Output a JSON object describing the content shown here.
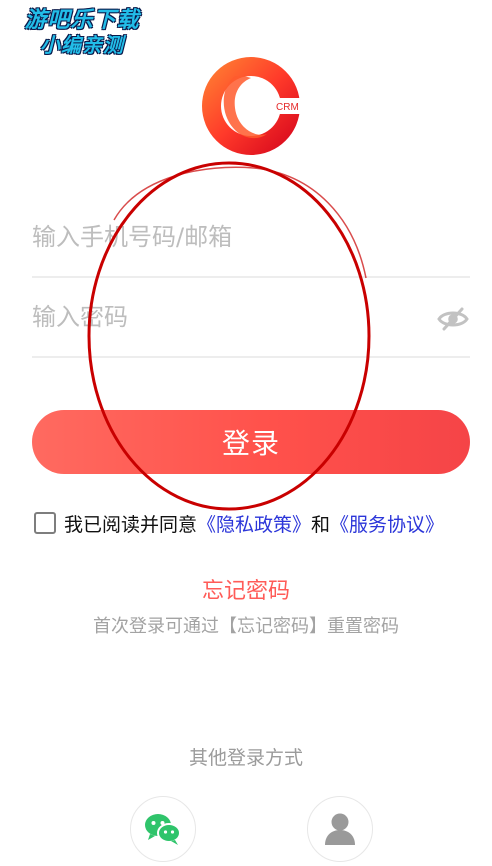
{
  "watermark": {
    "line1": "游吧乐下载",
    "line2": "小编亲测"
  },
  "logo": {
    "text": "CRM"
  },
  "form": {
    "phone_placeholder": "输入手机号码/邮箱",
    "password_placeholder": "输入密码",
    "password_toggle_icon": "eye-off-icon"
  },
  "login_button": {
    "label": "登录"
  },
  "agreement": {
    "prefix": "我已阅读并同意",
    "privacy": "《隐私政策》",
    "and": "和",
    "service": "《服务协议》"
  },
  "forgot": {
    "label": "忘记密码",
    "hint": "首次登录可通过【忘记密码】重置密码"
  },
  "other_login": {
    "label": "其他登录方式",
    "options": [
      {
        "icon": "wechat-icon"
      },
      {
        "icon": "user-icon"
      }
    ]
  },
  "colors": {
    "accent": "#ff5b57",
    "link": "#2b35d9",
    "wechat": "#2fc46b",
    "annotation": "#c90000"
  }
}
